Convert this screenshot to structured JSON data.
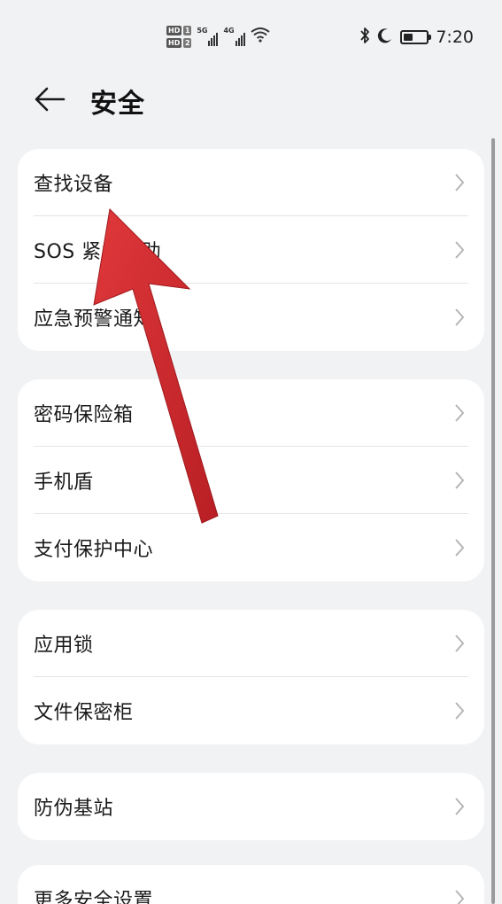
{
  "status_bar": {
    "sim1": {
      "hd": "HD",
      "slot": "1"
    },
    "sim2": {
      "hd": "HD",
      "slot": "2"
    },
    "net1": "5G",
    "net2": "4G",
    "time": "7:20",
    "battery_level": 0.4,
    "icons": [
      "wifi-icon",
      "bluetooth-icon",
      "do-not-disturb-moon-icon",
      "battery-icon"
    ]
  },
  "header": {
    "back_icon": "arrow-left-icon",
    "title": "安全"
  },
  "groups": [
    {
      "items": [
        {
          "label": "查找设备"
        },
        {
          "label": "SOS 紧急求助"
        },
        {
          "label": "应急预警通知"
        }
      ]
    },
    {
      "items": [
        {
          "label": "密码保险箱"
        },
        {
          "label": "手机盾"
        },
        {
          "label": "支付保护中心"
        }
      ]
    },
    {
      "items": [
        {
          "label": "应用锁"
        },
        {
          "label": "文件保密柜"
        }
      ]
    },
    {
      "items": [
        {
          "label": "防伪基站"
        }
      ]
    },
    {
      "items": [
        {
          "label": "更多安全设置"
        }
      ]
    }
  ],
  "colors": {
    "background": "#f1f2f4",
    "card": "#ffffff",
    "annotation_arrow": "#cf2a2e"
  }
}
